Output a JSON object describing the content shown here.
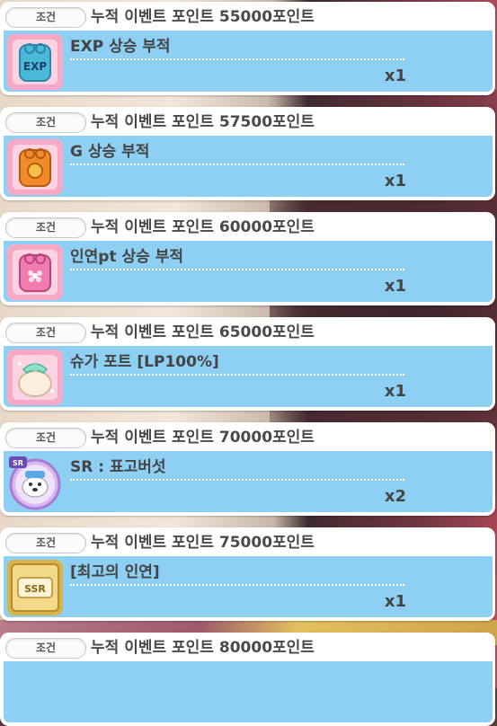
{
  "condition_label": "조건",
  "rewards": [
    {
      "condition": "누적 이벤트 포인트 55000포인트",
      "item": "EXP 상승 부적",
      "qty": "x1",
      "icon": "exp-charm-icon",
      "icon_text": "EXP"
    },
    {
      "condition": "누적 이벤트 포인트 57500포인트",
      "item": "G 상승 부적",
      "qty": "x1",
      "icon": "gold-charm-icon",
      "icon_text": ""
    },
    {
      "condition": "누적 이벤트 포인트 60000포인트",
      "item": "인연pt 상승 부적",
      "qty": "x1",
      "icon": "bond-charm-icon",
      "icon_text": ""
    },
    {
      "condition": "누적 이벤트 포인트 65000포인트",
      "item": "슈가 포트 [LP100%]",
      "qty": "x1",
      "icon": "sugar-pot-icon",
      "icon_text": ""
    },
    {
      "condition": "누적 이벤트 포인트 70000포인트",
      "item": "SR : 표고버섯",
      "qty": "x2",
      "icon": "sr-dog-icon",
      "icon_text": "SR"
    },
    {
      "condition": "누적 이벤트 포인트 75000포인트",
      "item": "[최고의 인연]",
      "qty": "x1",
      "icon": "ssr-ticket-icon",
      "icon_text": "SSR"
    },
    {
      "condition": "누적 이벤트 포인트 80000포인트",
      "item": "",
      "qty": "",
      "icon": "",
      "icon_text": ""
    }
  ],
  "colors": {
    "card_body": "#8dd0f3",
    "exp_charm": "#49b9d8",
    "gold_charm": "#f08a2a",
    "bond_charm": "#f27bb0",
    "ssr_gold": "#d8b24a"
  }
}
